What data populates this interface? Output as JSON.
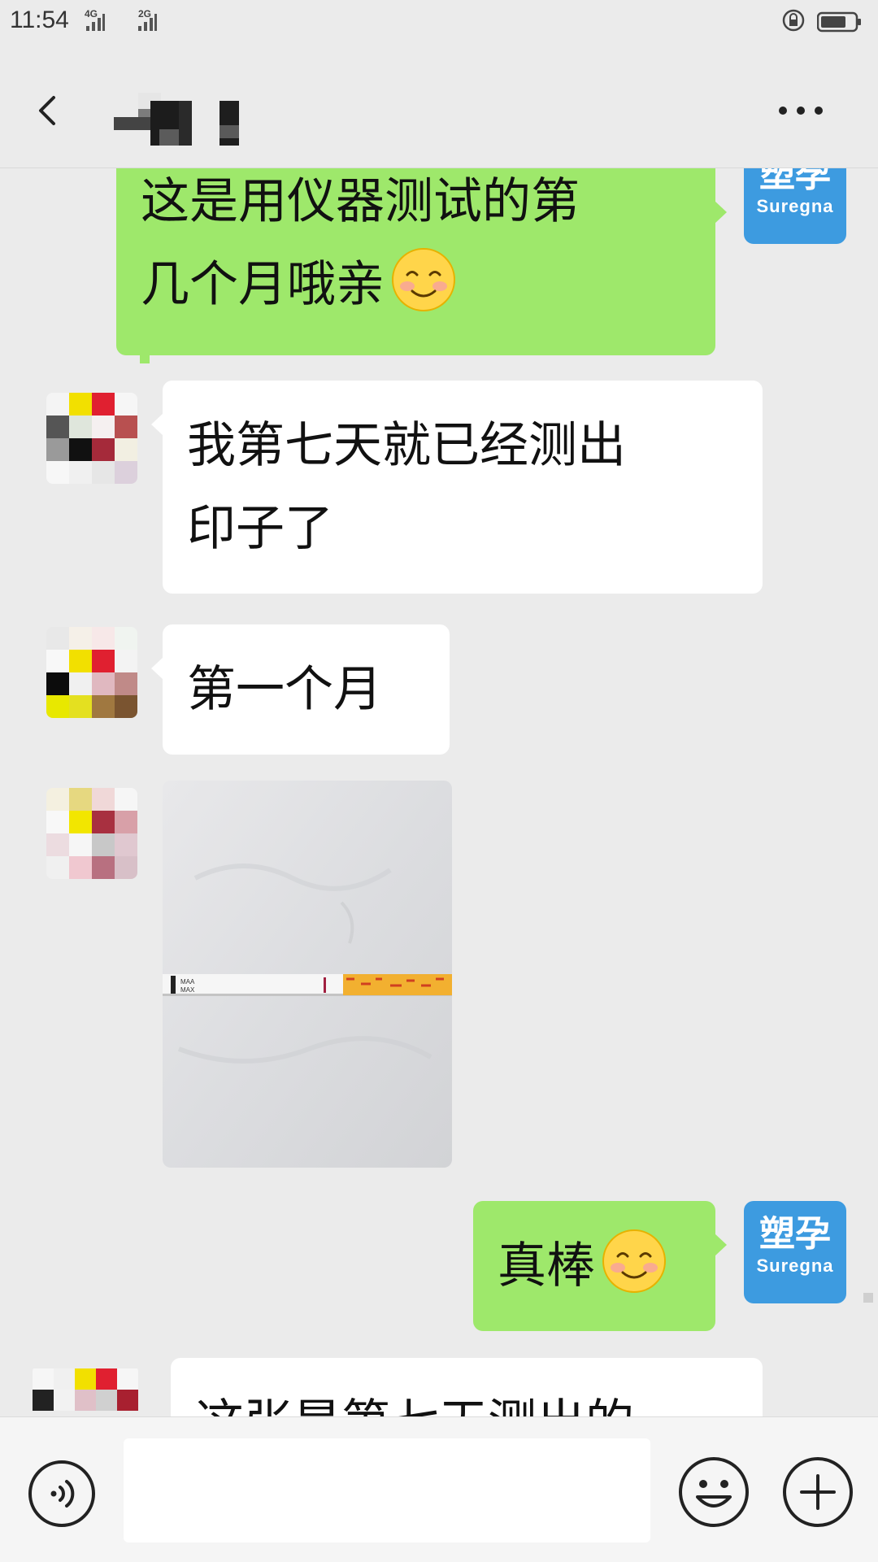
{
  "status_bar": {
    "time": "11:54",
    "network_1": "4G",
    "network_2": "2G"
  },
  "header": {
    "back_icon": "chevron-left-icon",
    "title": "(pixelated contact name)",
    "more_icon": "more-dots-icon"
  },
  "brand_avatar": {
    "chinese": "塑孕",
    "english": "Suregna",
    "color": "#3d9be0"
  },
  "messages": [
    {
      "side": "right",
      "type": "text",
      "line1": "这是用仪器测试的第",
      "line2": "几个月哦亲",
      "emoji": "smile-emoji-icon"
    },
    {
      "side": "left",
      "type": "text",
      "line1": "我第七天就已经测出",
      "line2": "印子了"
    },
    {
      "side": "left",
      "type": "text",
      "line1": "第一个月"
    },
    {
      "side": "left",
      "type": "image",
      "image": "ovulation-test-strip-photo",
      "strip_labels": [
        "MAA",
        "MAX"
      ]
    },
    {
      "side": "right",
      "type": "text",
      "line1": "真棒",
      "emoji": "smile-emoji-icon"
    },
    {
      "side": "left",
      "type": "text",
      "line1": "这张是第七天测出的"
    }
  ],
  "input_bar": {
    "voice_icon": "voice-icon",
    "placeholder": "",
    "emoji_icon": "emoji-face-icon",
    "plus_icon": "plus-circle-icon"
  },
  "colors": {
    "green_bubble": "#9ee86b",
    "white_bubble": "#ffffff",
    "background": "#ebebeb"
  }
}
